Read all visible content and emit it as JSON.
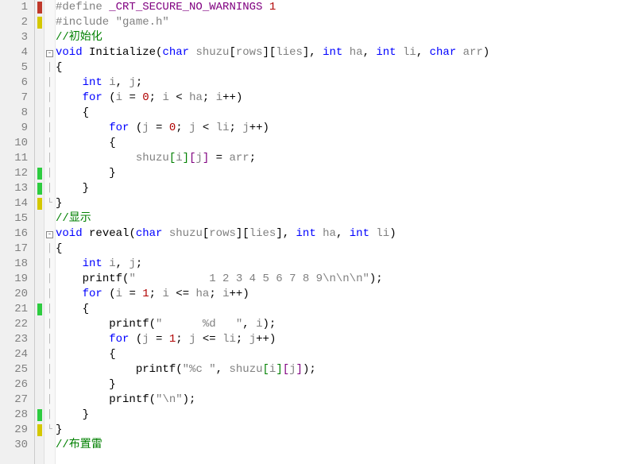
{
  "lines": [
    {
      "n": 1,
      "marker": "red",
      "fold": "",
      "tokens": [
        [
          "preproc",
          "#define "
        ],
        [
          "define-name",
          "_CRT_SECURE_NO_WARNINGS"
        ],
        [
          "preproc",
          " "
        ],
        [
          "number",
          "1"
        ]
      ]
    },
    {
      "n": 2,
      "marker": "yellow",
      "fold": "",
      "tokens": [
        [
          "preproc",
          "#include "
        ],
        [
          "str",
          "\"game.h\""
        ]
      ]
    },
    {
      "n": 3,
      "marker": "",
      "fold": "",
      "tokens": [
        [
          "comment",
          "//初始化"
        ]
      ]
    },
    {
      "n": 4,
      "marker": "",
      "fold": "box",
      "tokens": [
        [
          "type",
          "void"
        ],
        [
          "op",
          " "
        ],
        [
          "func",
          "Initialize"
        ],
        [
          "op",
          "("
        ],
        [
          "type",
          "char"
        ],
        [
          "op",
          " "
        ],
        [
          "param",
          "shuzu"
        ],
        [
          "op",
          "["
        ],
        [
          "ident",
          "rows"
        ],
        [
          "op",
          "]["
        ],
        [
          "ident",
          "lies"
        ],
        [
          "op",
          "], "
        ],
        [
          "type",
          "int"
        ],
        [
          "op",
          " "
        ],
        [
          "param",
          "ha"
        ],
        [
          "op",
          ", "
        ],
        [
          "type",
          "int"
        ],
        [
          "op",
          " "
        ],
        [
          "param",
          "li"
        ],
        [
          "op",
          ", "
        ],
        [
          "type",
          "char"
        ],
        [
          "op",
          " "
        ],
        [
          "param",
          "arr"
        ],
        [
          "op",
          ")\n"
        ]
      ]
    },
    {
      "n": 5,
      "marker": "",
      "fold": "|",
      "tokens": [
        [
          "op",
          "{"
        ]
      ]
    },
    {
      "n": 6,
      "marker": "",
      "fold": "|",
      "tokens": [
        [
          "op",
          "    "
        ],
        [
          "type",
          "int"
        ],
        [
          "op",
          " "
        ],
        [
          "ident",
          "i"
        ],
        [
          "op",
          ", "
        ],
        [
          "ident",
          "j"
        ],
        [
          "op",
          ";"
        ]
      ]
    },
    {
      "n": 7,
      "marker": "",
      "fold": "|",
      "tokens": [
        [
          "op",
          "    "
        ],
        [
          "keyword",
          "for"
        ],
        [
          "op",
          " ("
        ],
        [
          "ident",
          "i"
        ],
        [
          "op",
          " = "
        ],
        [
          "number",
          "0"
        ],
        [
          "op",
          "; "
        ],
        [
          "ident",
          "i"
        ],
        [
          "op",
          " < "
        ],
        [
          "ident",
          "ha"
        ],
        [
          "op",
          "; "
        ],
        [
          "ident",
          "i"
        ],
        [
          "op",
          "++)"
        ]
      ]
    },
    {
      "n": 8,
      "marker": "",
      "fold": "|",
      "tokens": [
        [
          "op",
          "    {"
        ]
      ]
    },
    {
      "n": 9,
      "marker": "",
      "fold": "|",
      "tokens": [
        [
          "op",
          "        "
        ],
        [
          "keyword",
          "for"
        ],
        [
          "op",
          " ("
        ],
        [
          "ident",
          "j"
        ],
        [
          "op",
          " = "
        ],
        [
          "number",
          "0"
        ],
        [
          "op",
          "; "
        ],
        [
          "ident",
          "j"
        ],
        [
          "op",
          " < "
        ],
        [
          "ident",
          "li"
        ],
        [
          "op",
          "; "
        ],
        [
          "ident",
          "j"
        ],
        [
          "op",
          "++)"
        ]
      ]
    },
    {
      "n": 10,
      "marker": "",
      "fold": "|",
      "tokens": [
        [
          "op",
          "        {"
        ]
      ]
    },
    {
      "n": 11,
      "marker": "",
      "fold": "|",
      "tokens": [
        [
          "op",
          "            "
        ],
        [
          "ident",
          "shuzu"
        ],
        [
          "bracket-g",
          "["
        ],
        [
          "ident",
          "i"
        ],
        [
          "bracket-g",
          "]"
        ],
        [
          "bracket-p",
          "["
        ],
        [
          "ident",
          "j"
        ],
        [
          "bracket-p",
          "]"
        ],
        [
          "op",
          " = "
        ],
        [
          "ident",
          "arr"
        ],
        [
          "op",
          ";"
        ]
      ]
    },
    {
      "n": 12,
      "marker": "green",
      "fold": "|",
      "tokens": [
        [
          "op",
          "        }"
        ]
      ]
    },
    {
      "n": 13,
      "marker": "green",
      "fold": "|",
      "tokens": [
        [
          "op",
          "    }"
        ]
      ]
    },
    {
      "n": 14,
      "marker": "yellow",
      "fold": "L",
      "tokens": [
        [
          "op",
          "}"
        ]
      ]
    },
    {
      "n": 15,
      "marker": "",
      "fold": "",
      "tokens": [
        [
          "comment",
          "//显示"
        ]
      ]
    },
    {
      "n": 16,
      "marker": "",
      "fold": "box",
      "tokens": [
        [
          "type",
          "void"
        ],
        [
          "op",
          " "
        ],
        [
          "func",
          "reveal"
        ],
        [
          "op",
          "("
        ],
        [
          "type",
          "char"
        ],
        [
          "op",
          " "
        ],
        [
          "param",
          "shuzu"
        ],
        [
          "op",
          "["
        ],
        [
          "ident",
          "rows"
        ],
        [
          "op",
          "]["
        ],
        [
          "ident",
          "lies"
        ],
        [
          "op",
          "], "
        ],
        [
          "type",
          "int"
        ],
        [
          "op",
          " "
        ],
        [
          "param",
          "ha"
        ],
        [
          "op",
          ", "
        ],
        [
          "type",
          "int"
        ],
        [
          "op",
          " "
        ],
        [
          "param",
          "li"
        ],
        [
          "op",
          ")"
        ]
      ]
    },
    {
      "n": 17,
      "marker": "",
      "fold": "|",
      "tokens": [
        [
          "op",
          "{"
        ]
      ]
    },
    {
      "n": 18,
      "marker": "",
      "fold": "|",
      "tokens": [
        [
          "op",
          "    "
        ],
        [
          "type",
          "int"
        ],
        [
          "op",
          " "
        ],
        [
          "ident",
          "i"
        ],
        [
          "op",
          ", "
        ],
        [
          "ident",
          "j"
        ],
        [
          "op",
          ";"
        ]
      ]
    },
    {
      "n": 19,
      "marker": "",
      "fold": "|",
      "tokens": [
        [
          "op",
          "    "
        ],
        [
          "func",
          "printf"
        ],
        [
          "op",
          "("
        ],
        [
          "str",
          "\"           1 2 3 4 5 6 7 8 9\\n\\n\\n\""
        ],
        [
          "op",
          ");"
        ]
      ]
    },
    {
      "n": 20,
      "marker": "",
      "fold": "|",
      "tokens": [
        [
          "op",
          "    "
        ],
        [
          "keyword",
          "for"
        ],
        [
          "op",
          " ("
        ],
        [
          "ident",
          "i"
        ],
        [
          "op",
          " = "
        ],
        [
          "number",
          "1"
        ],
        [
          "op",
          "; "
        ],
        [
          "ident",
          "i"
        ],
        [
          "op",
          " <= "
        ],
        [
          "ident",
          "ha"
        ],
        [
          "op",
          "; "
        ],
        [
          "ident",
          "i"
        ],
        [
          "op",
          "++)"
        ]
      ]
    },
    {
      "n": 21,
      "marker": "green",
      "fold": "|",
      "tokens": [
        [
          "op",
          "    {"
        ]
      ]
    },
    {
      "n": 22,
      "marker": "",
      "fold": "|",
      "tokens": [
        [
          "op",
          "        "
        ],
        [
          "func",
          "printf"
        ],
        [
          "op",
          "("
        ],
        [
          "str",
          "\"      %d   \""
        ],
        [
          "op",
          ", "
        ],
        [
          "ident",
          "i"
        ],
        [
          "op",
          ");"
        ]
      ]
    },
    {
      "n": 23,
      "marker": "",
      "fold": "|",
      "tokens": [
        [
          "op",
          "        "
        ],
        [
          "keyword",
          "for"
        ],
        [
          "op",
          " ("
        ],
        [
          "ident",
          "j"
        ],
        [
          "op",
          " = "
        ],
        [
          "number",
          "1"
        ],
        [
          "op",
          "; "
        ],
        [
          "ident",
          "j"
        ],
        [
          "op",
          " <= "
        ],
        [
          "ident",
          "li"
        ],
        [
          "op",
          "; "
        ],
        [
          "ident",
          "j"
        ],
        [
          "op",
          "++)"
        ]
      ]
    },
    {
      "n": 24,
      "marker": "",
      "fold": "|",
      "tokens": [
        [
          "op",
          "        {"
        ]
      ]
    },
    {
      "n": 25,
      "marker": "",
      "fold": "|",
      "tokens": [
        [
          "op",
          "            "
        ],
        [
          "func",
          "printf"
        ],
        [
          "op",
          "("
        ],
        [
          "str",
          "\"%c \""
        ],
        [
          "op",
          ", "
        ],
        [
          "ident",
          "shuzu"
        ],
        [
          "bracket-g",
          "["
        ],
        [
          "ident",
          "i"
        ],
        [
          "bracket-g",
          "]"
        ],
        [
          "bracket-p",
          "["
        ],
        [
          "ident",
          "j"
        ],
        [
          "bracket-p",
          "]"
        ],
        [
          "op",
          ");"
        ]
      ]
    },
    {
      "n": 26,
      "marker": "",
      "fold": "|",
      "tokens": [
        [
          "op",
          "        }"
        ]
      ]
    },
    {
      "n": 27,
      "marker": "",
      "fold": "|",
      "tokens": [
        [
          "op",
          "        "
        ],
        [
          "func",
          "printf"
        ],
        [
          "op",
          "("
        ],
        [
          "str",
          "\"\\n\""
        ],
        [
          "op",
          ");"
        ]
      ]
    },
    {
      "n": 28,
      "marker": "green",
      "fold": "|",
      "tokens": [
        [
          "op",
          "    }"
        ]
      ]
    },
    {
      "n": 29,
      "marker": "yellow",
      "fold": "L",
      "tokens": [
        [
          "op",
          "}"
        ]
      ]
    },
    {
      "n": 30,
      "marker": "",
      "fold": "",
      "tokens": [
        [
          "comment",
          "//布置雷"
        ]
      ]
    }
  ]
}
